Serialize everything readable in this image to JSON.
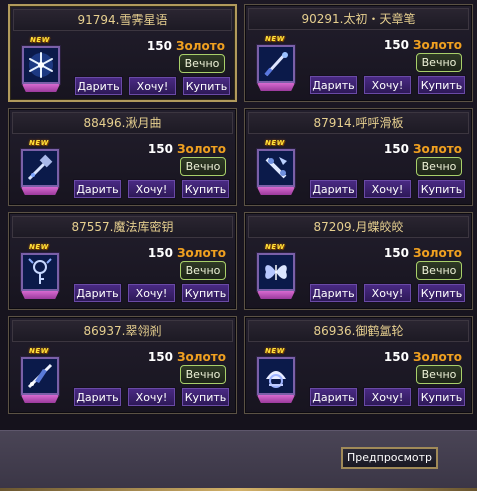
{
  "items": [
    {
      "title": "91794.雪霁星语",
      "price": "150",
      "currency": "Золото",
      "duration": "Вечно",
      "badge": "NEW",
      "icon": "snowflake-star-icon",
      "selected": true
    },
    {
      "title": "90291.太初・天章笔",
      "price": "150",
      "currency": "Золото",
      "duration": "Вечно",
      "badge": "NEW",
      "icon": "celestial-brush-icon",
      "selected": false
    },
    {
      "title": "88496.湫月曲",
      "price": "150",
      "currency": "Золото",
      "duration": "Вечно",
      "badge": "NEW",
      "icon": "moon-song-icon",
      "selected": false
    },
    {
      "title": "87914.呼呼滑板",
      "price": "150",
      "currency": "Золото",
      "duration": "Вечно",
      "badge": "NEW",
      "icon": "skateboard-icon",
      "selected": false
    },
    {
      "title": "87557.魔法库密钥",
      "price": "150",
      "currency": "Золото",
      "duration": "Вечно",
      "badge": "NEW",
      "icon": "magic-vault-key-icon",
      "selected": false
    },
    {
      "title": "87209.月蝶皎皎",
      "price": "150",
      "currency": "Золото",
      "duration": "Вечно",
      "badge": "NEW",
      "icon": "moon-butterfly-icon",
      "selected": false
    },
    {
      "title": "86937.翠翎剎",
      "price": "150",
      "currency": "Золото",
      "duration": "Вечно",
      "badge": "NEW",
      "icon": "jade-feather-icon",
      "selected": false
    },
    {
      "title": "86936.御鹤氲轮",
      "price": "150",
      "currency": "Золото",
      "duration": "Вечно",
      "badge": "NEW",
      "icon": "crane-wheel-icon",
      "selected": false
    }
  ],
  "buttons": {
    "gift": "Дарить",
    "want": "Хочу!",
    "buy": "Купить"
  },
  "footer": {
    "preview_label": "Предпросмотр"
  },
  "colors": {
    "title_text": "#e6cf8f",
    "currency": "#f0a020",
    "duration_border": "#a9d06a",
    "button": "#3b2370",
    "frame_gold": "#b19a5c"
  }
}
